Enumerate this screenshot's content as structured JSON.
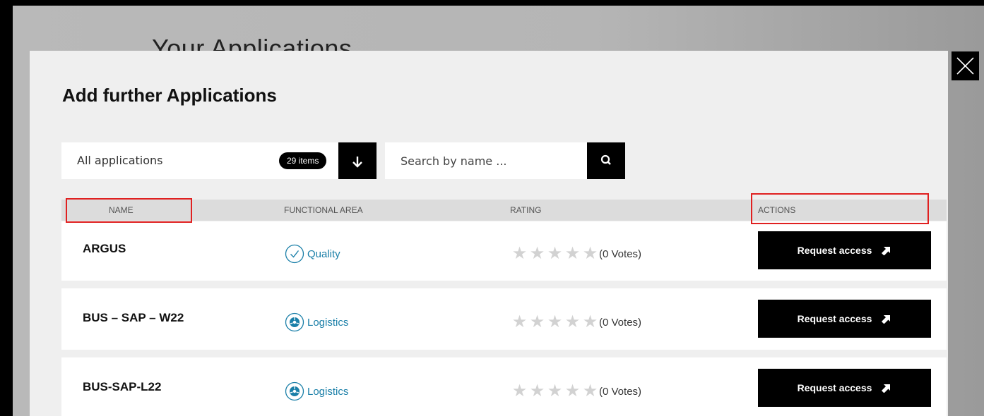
{
  "background": {
    "title": "Your Applications"
  },
  "modal": {
    "title": "Add further Applications",
    "filter": {
      "label": "All applications",
      "count": "29 items"
    },
    "search": {
      "placeholder": "Search by name ..."
    },
    "columns": {
      "name": "NAME",
      "area": "FUNCTIONAL AREA",
      "rating": "RATING",
      "actions": "ACTIONS"
    },
    "rows": [
      {
        "name": "ARGUS",
        "area": "Quality",
        "area_icon": "check-circle-icon",
        "votes": "(0 Votes)",
        "rating": 0,
        "action": "Request access"
      },
      {
        "name": "BUS – SAP – W22",
        "area": "Logistics",
        "area_icon": "logistics-icon",
        "votes": "(0 Votes)",
        "rating": 0,
        "action": "Request access"
      },
      {
        "name": "BUS-SAP-L22",
        "area": "Logistics",
        "area_icon": "logistics-icon",
        "votes": "(0 Votes)",
        "rating": 0,
        "action": "Request access"
      }
    ]
  },
  "colors": {
    "accent": "#1a7fa8",
    "highlight": "#e02020",
    "button": "#000000"
  }
}
